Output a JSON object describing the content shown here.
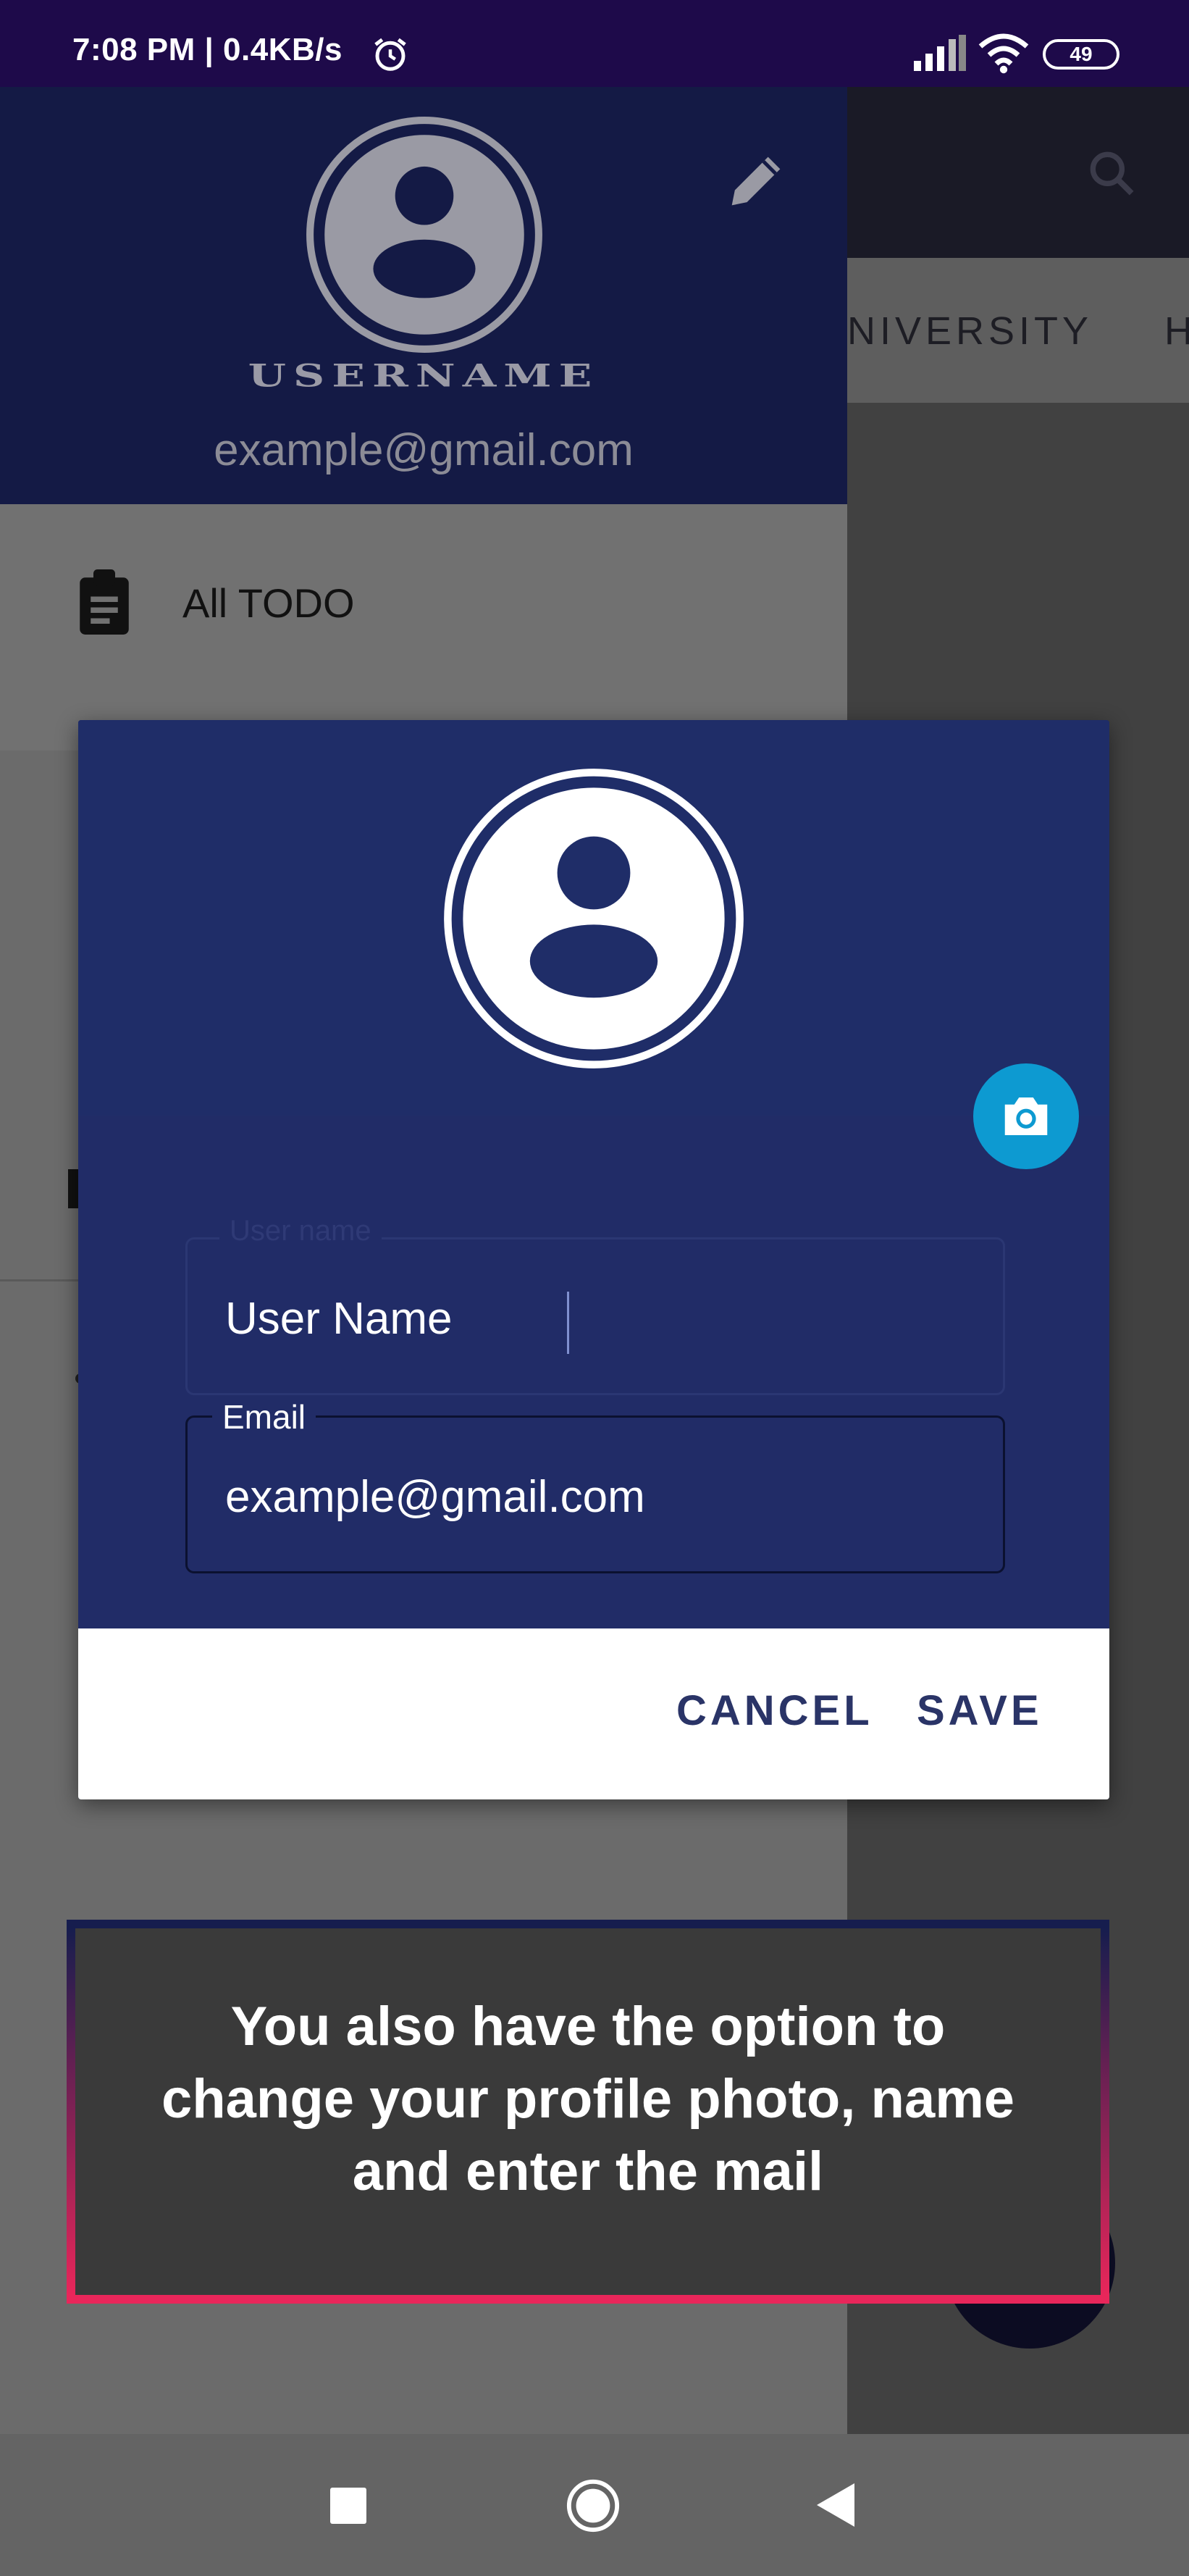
{
  "status_bar": {
    "time": "7:08 PM | 0.4KB/s",
    "battery": "49"
  },
  "app": {
    "tab_partial_1": "NIVERSITY",
    "tab_partial_2": "H"
  },
  "drawer": {
    "username": "USERNAME",
    "email": "example@gmail.com",
    "items": [
      {
        "label": "All TODO",
        "icon": "clipboard-icon"
      }
    ]
  },
  "dialog": {
    "username_label": "User name",
    "username_value": "User Name",
    "email_label": "Email",
    "email_value": "example@gmail.com",
    "cancel_label": "CANCEL",
    "save_label": "SAVE"
  },
  "tip": {
    "text": "You also have the option to change your profile photo, name and enter the mail"
  },
  "colors": {
    "status_bar": "#1e0a4a",
    "drawer_header": "#141a45",
    "dialog_bg": "#212c67",
    "camera_button": "#0d9ad1",
    "tip_border_top": "#161d4e",
    "tip_border_bottom": "#e8265a"
  }
}
